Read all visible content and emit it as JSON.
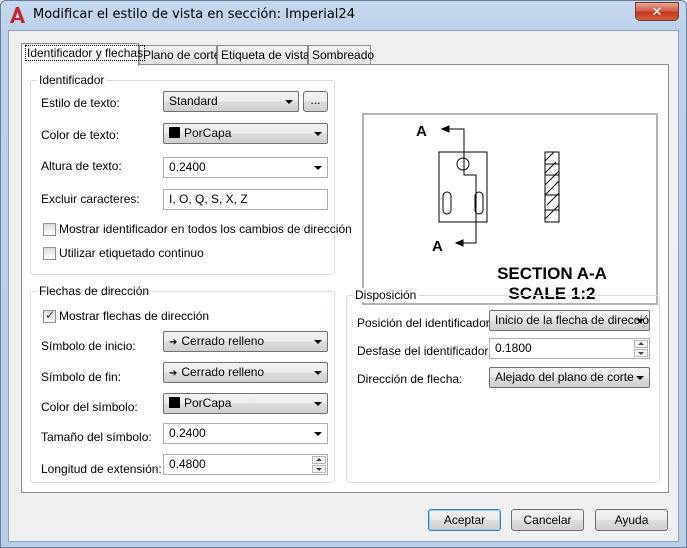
{
  "window": {
    "title": "Modificar el estilo de vista en sección: Imperial24",
    "close_glyph": "✕"
  },
  "tabs": [
    {
      "label": "Identificador y flechas"
    },
    {
      "label": "Plano de corte"
    },
    {
      "label": "Etiqueta de vista"
    },
    {
      "label": "Sombreado"
    }
  ],
  "identificador": {
    "title": "Identificador",
    "estilo_label": "Estilo de texto:",
    "estilo_value": "Standard",
    "browse_label": "...",
    "color_label": "Color de texto:",
    "color_value": "PorCapa",
    "altura_label": "Altura de texto:",
    "altura_value": "0.2400",
    "excluir_label": "Excluir caracteres:",
    "excluir_value": "I, O, Q, S, X, Z",
    "mostrar_label": "Mostrar identificador en todos los cambios de dirección",
    "mostrar_checked": false,
    "continuo_label": "Utilizar etiquetado continuo",
    "continuo_checked": false
  },
  "preview": {
    "label_top": "A",
    "label_bottom": "A",
    "caption_line1": "SECTION A-A",
    "caption_line2": "SCALE 1:2"
  },
  "flechas": {
    "title": "Flechas de dirección",
    "mostrar_label": "Mostrar flechas de dirección",
    "mostrar_checked": true,
    "inicio_label": "Símbolo de inicio:",
    "inicio_value": "Cerrado relleno",
    "fin_label": "Símbolo de fin:",
    "fin_value": "Cerrado relleno",
    "color_label": "Color del símbolo:",
    "color_value": "PorCapa",
    "tamano_label": "Tamaño del símbolo:",
    "tamano_value": "0.2400",
    "longitud_label": "Longitud de extensión:",
    "longitud_value": "0.4800"
  },
  "disposicion": {
    "title": "Disposición",
    "posicion_label": "Posición del identificador:",
    "posicion_value": "Inicio de la flecha de direcció",
    "desfase_label": "Desfase del identificador:",
    "desfase_value": "0.1800",
    "direccion_label": "Dirección de flecha:",
    "direccion_value": "Alejado del plano de corte"
  },
  "buttons": {
    "aceptar": "Aceptar",
    "cancelar": "Cancelar",
    "ayuda": "Ayuda"
  },
  "colors": {
    "accent": "#c1272d",
    "swatch": "#000000"
  }
}
